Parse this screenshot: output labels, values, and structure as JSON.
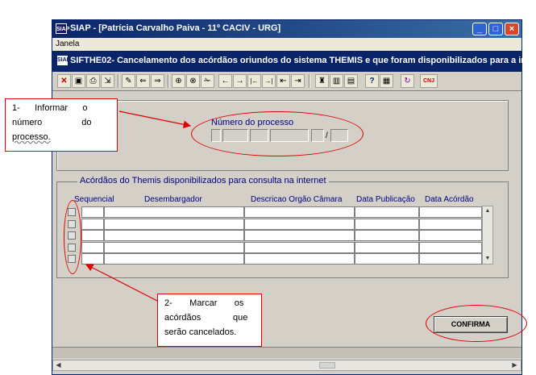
{
  "window": {
    "title": "SIAP - [Patrícia Carvalho Paiva - 11º CACIV - URG]",
    "app_icon": "SIAP",
    "buttons": {
      "minimize": "_",
      "maximize": "□",
      "close": "×"
    }
  },
  "menubar": {
    "items": [
      "Janela"
    ]
  },
  "subtitle": {
    "icon": "SIAP",
    "text": "SIFTHE02- Cancelamento dos acórdãos oriundos do sistema THEMIS e que foram disponibilizados para a inter..."
  },
  "toolbar": {
    "icons": [
      "close-x-icon",
      "save-icon",
      "print-icon",
      "exit-icon",
      "edit-icon",
      "import-icon",
      "export-icon",
      "new-record-icon",
      "delete-record-icon",
      "clear-icon",
      "arrow-left-icon",
      "arrow-right-icon",
      "first-record-icon",
      "last-record-icon",
      "goto-icon",
      "export2-icon",
      "user-icon",
      "report-icon",
      "report2-icon",
      "help-icon",
      "calendar-icon",
      "refresh-icon",
      "cnj-icon"
    ],
    "glyphs": [
      "✕",
      "▣",
      "⎙",
      "⇲",
      "✎",
      "⇐",
      "⇒",
      "⊕",
      "⊗",
      "✁",
      "←",
      "→",
      "|←",
      "→|",
      "⇤",
      "⇥",
      "♜",
      "▥",
      "▤",
      "?",
      "▦",
      "↻",
      "CNJ"
    ],
    "colors": {
      "close": "#cc0000",
      "accent": "#0a246a"
    }
  },
  "processo": {
    "label": "Número do processo",
    "separator": "/"
  },
  "acordaos": {
    "legend": "Acórdãos do Themis disponibilizados para consulta na internet",
    "columns": [
      "Sequencial",
      "Desembargador",
      "Descricao Orgão Câmara",
      "Data Publicação",
      "Data Acórdão"
    ],
    "rows": 5
  },
  "confirm_button": {
    "label": "CONFIRMA"
  },
  "scrollbar": {
    "up": "▲",
    "down": "▼",
    "left": "◀",
    "right": "▶"
  },
  "callouts": {
    "c1": {
      "lines": [
        "1-      Informar      o",
        "número                do",
        "processo."
      ]
    },
    "c2": {
      "lines": [
        "2-       Marcar       os",
        "acórdãos             que",
        "serão cancelados."
      ]
    }
  },
  "annotation_color": "#e00000"
}
